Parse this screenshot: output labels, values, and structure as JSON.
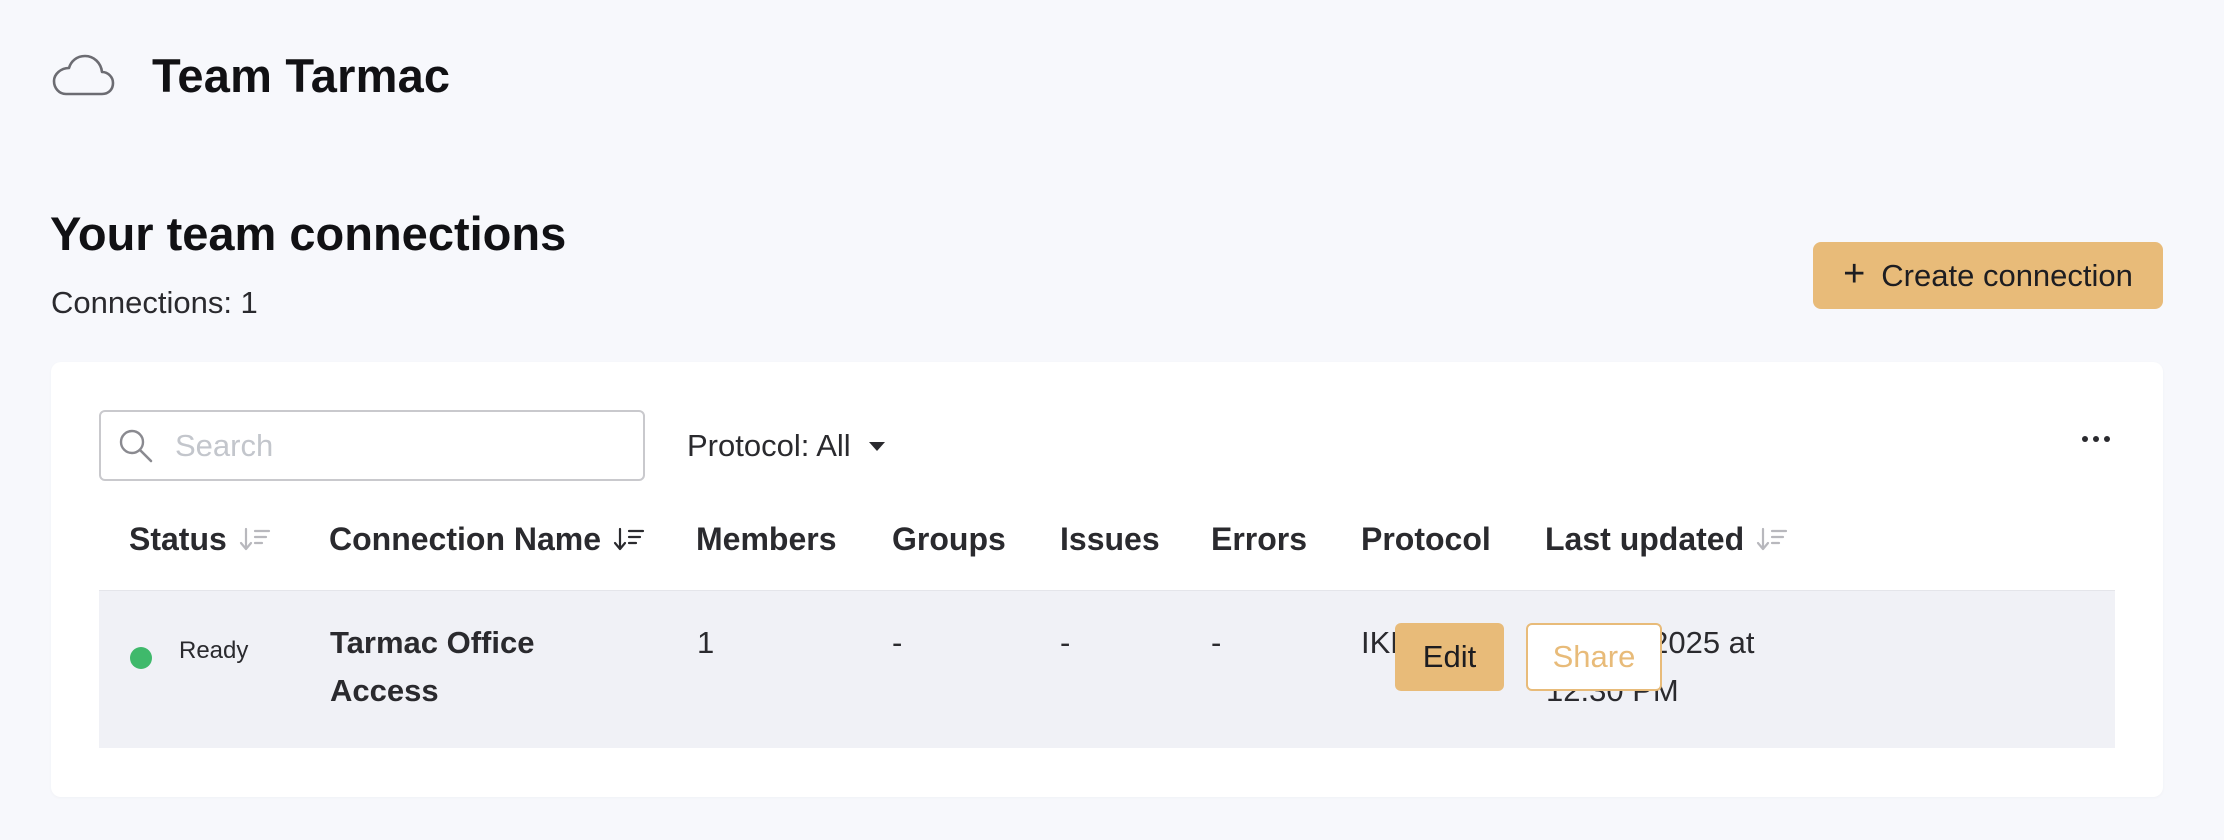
{
  "header": {
    "title": "Team Tarmac",
    "icon": "cloud-icon"
  },
  "section": {
    "title": "Your team connections",
    "count_label": "Connections: 1"
  },
  "create_button": {
    "icon": "plus",
    "label": "Create connection",
    "color": "#e8bb79"
  },
  "toolbar": {
    "search_placeholder": "Search",
    "search_value": "",
    "protocol_filter": "Protocol: All",
    "more_icon": "more-horizontal-icon"
  },
  "table": {
    "columns": [
      {
        "label": "Status",
        "sortable": true
      },
      {
        "label": "Connection Name",
        "sortable": true
      },
      {
        "label": "Members",
        "sortable": false
      },
      {
        "label": "Groups",
        "sortable": false
      },
      {
        "label": "Issues",
        "sortable": false
      },
      {
        "label": "Errors",
        "sortable": false
      },
      {
        "label": "Protocol",
        "sortable": false
      },
      {
        "label": "Last updated",
        "sortable": true
      }
    ],
    "rows": [
      {
        "status": "Ready",
        "status_color": "#3fb96b",
        "name": "Tarmac Office Access",
        "members": "1",
        "groups": "-",
        "issues": "-",
        "errors": "-",
        "protocol": "IKEv2",
        "last_updated": "April 8, 2025 at 12:30 PM",
        "edit_label": "Edit",
        "share_label": "Share"
      }
    ]
  }
}
